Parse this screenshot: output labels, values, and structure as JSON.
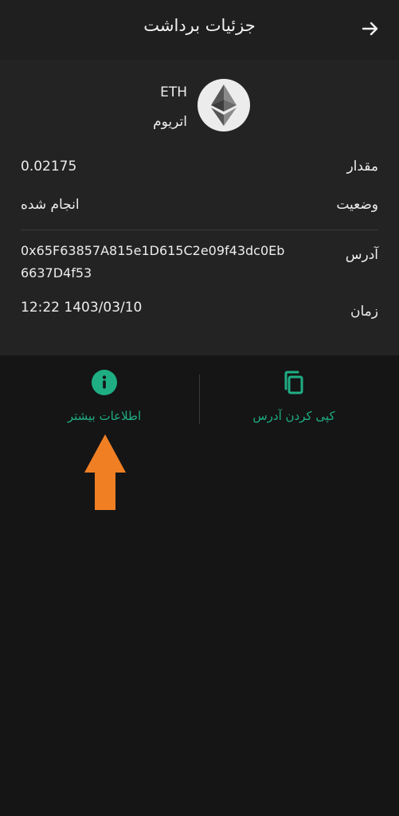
{
  "header": {
    "title": "جزئیات برداشت",
    "back_icon": "arrow-right-icon"
  },
  "coin": {
    "symbol": "ETH",
    "name": "اتریوم",
    "icon": "ethereum-icon"
  },
  "details": {
    "amount_label": "مقدار",
    "amount_value": "0.02175",
    "status_label": "وضعیت",
    "status_value": "انجام شده",
    "address_label": "آدرس",
    "address_value": "0x65F63857A815e1D615C2e09f43dc0Eb6637D4f53",
    "time_label": "زمان",
    "time_value": "12:22 1403/03/10"
  },
  "actions": {
    "copy_address_label": "کپی کردن آدرس",
    "more_info_label": "اطلاعات بیشتر",
    "copy_icon": "copy-icon",
    "info_icon": "info-icon"
  },
  "colors": {
    "background": "#151515",
    "card": "#232323",
    "header": "#1f1f1f",
    "accent": "#1fae84",
    "pointer": "#f07f24"
  }
}
